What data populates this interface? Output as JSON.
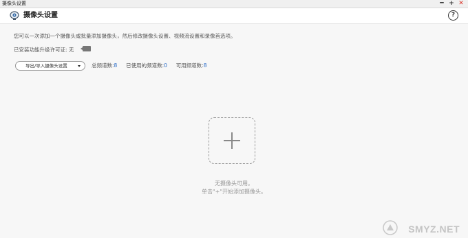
{
  "window": {
    "title": "摄像头设置",
    "minimize": "━",
    "maximize": "+",
    "close": "✕"
  },
  "header": {
    "title": "摄像头设置",
    "help": "?"
  },
  "content": {
    "description": "您可以一次添加一个摄像头或批量添加摄像头，然后修改摄像头设置、视频流设置和录像首选项。",
    "license_label": "已安装功能升级许可证: 无",
    "dropdown_label": "导出/导入摄像头设置",
    "stats": {
      "total_label": "总频道数:",
      "total_value": "8",
      "used_label": "已使用的频道数:",
      "used_value": "0",
      "available_label": "可用频道数:",
      "available_value": "8"
    },
    "empty_line1": "无摄像头可用。",
    "empty_line2": "单击\"+\"开始添加摄像头。"
  },
  "watermark": {
    "text": "SMYZ.NET"
  },
  "colors": {
    "accent": "#2a6cc7",
    "close": "#d93025",
    "background": "#f7f7f7"
  }
}
